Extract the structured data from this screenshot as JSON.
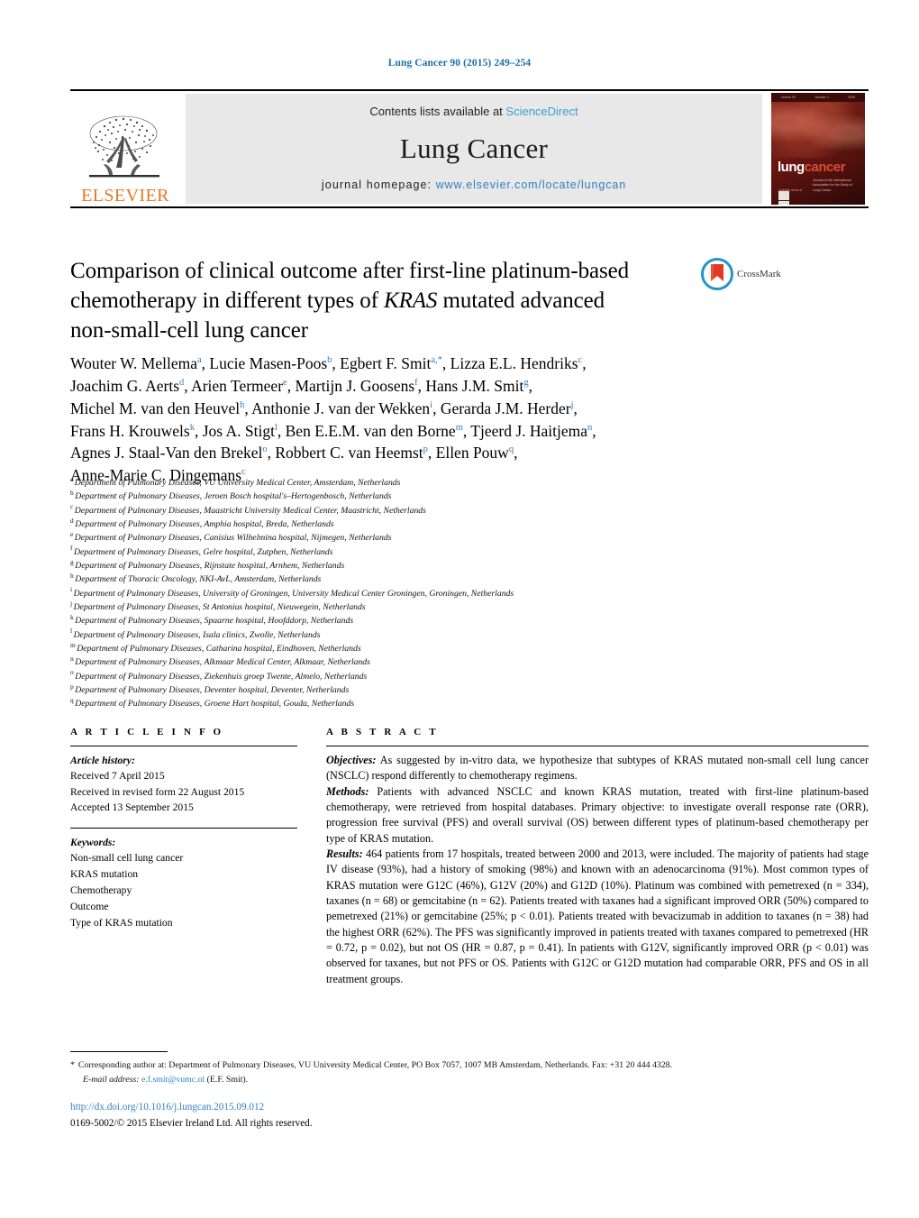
{
  "running_head": "Lung Cancer 90 (2015) 249–254",
  "masthead": {
    "publisher_name": "ELSEVIER",
    "contents_prefix": "Contents lists available at ",
    "contents_link": "ScienceDirect",
    "journal_title": "Lung Cancer",
    "homepage_label": "journal homepage:",
    "homepage_url": "www.elsevier.com/locate/lungcan",
    "cover": {
      "logo_first": "lung",
      "logo_second": "cancer",
      "subtitle": "Journal of the International Association for the Study of Lung Cancer",
      "availability": "Available online at"
    }
  },
  "article": {
    "title_line1": "Comparison of clinical outcome after first-line platinum-based",
    "title_line2_a": "chemotherapy in different types of ",
    "title_line2_italic": "KRAS",
    "title_line2_b": " mutated advanced",
    "title_line3": "non-small-cell lung cancer",
    "crossmark_label": "CrossMark"
  },
  "authors": [
    {
      "name": "Wouter W. Mellema",
      "sup": "a",
      "sep": ", "
    },
    {
      "name": "Lucie Masen-Poos",
      "sup": "b",
      "sep": ", "
    },
    {
      "name": "Egbert F. Smit",
      "sup": "a,*",
      "sep": ", "
    },
    {
      "name": "Lizza E.L. Hendriks",
      "sup": "c",
      "sep": ", "
    },
    {
      "name": "Joachim G. Aerts",
      "sup": "d",
      "sep": ", "
    },
    {
      "name": "Arien Termeer",
      "sup": "e",
      "sep": ", "
    },
    {
      "name": "Martijn J. Goosens",
      "sup": "f",
      "sep": ", "
    },
    {
      "name": "Hans J.M. Smit",
      "sup": "g",
      "sep": ", "
    },
    {
      "name": "Michel M. van den Heuvel",
      "sup": "h",
      "sep": ", "
    },
    {
      "name": "Anthonie J. van der Wekken",
      "sup": "i",
      "sep": ", "
    },
    {
      "name": "Gerarda J.M. Herder",
      "sup": "j",
      "sep": ", "
    },
    {
      "name": "Frans H. Krouwels",
      "sup": "k",
      "sep": ", "
    },
    {
      "name": "Jos A. Stigt",
      "sup": "l",
      "sep": ", "
    },
    {
      "name": "Ben E.E.M. van den Borne",
      "sup": "m",
      "sep": ", "
    },
    {
      "name": "Tjeerd J. Haitjema",
      "sup": "n",
      "sep": ", "
    },
    {
      "name": "Agnes J. Staal-Van den Brekel",
      "sup": "o",
      "sep": ", "
    },
    {
      "name": "Robbert C. van Heemst",
      "sup": "p",
      "sep": ", "
    },
    {
      "name": "Ellen Pouw",
      "sup": "q",
      "sep": ", "
    },
    {
      "name": "Anne-Marie C. Dingemans",
      "sup": "c",
      "sep": ""
    }
  ],
  "affiliations": [
    {
      "mark": "a",
      "text": "Department of Pulmonary Diseases, VU University Medical Center, Amsterdam, Netherlands"
    },
    {
      "mark": "b",
      "text": "Department of Pulmonary Diseases, Jeroen Bosch hospital's–Hertogenbosch, Netherlands"
    },
    {
      "mark": "c",
      "text": "Department of Pulmonary Diseases, Maastricht University Medical Center, Maastricht, Netherlands"
    },
    {
      "mark": "d",
      "text": "Department of Pulmonary Diseases, Amphia hospital, Breda, Netherlands"
    },
    {
      "mark": "e",
      "text": "Department of Pulmonary Diseases, Canisius Wilhelmina hospital, Nijmegen, Netherlands"
    },
    {
      "mark": "f",
      "text": "Department of Pulmonary Diseases, Gelre hospital, Zutphen, Netherlands"
    },
    {
      "mark": "g",
      "text": "Department of Pulmonary Diseases, Rijnstate hospital, Arnhem, Netherlands"
    },
    {
      "mark": "h",
      "text": "Department of Thoracic Oncology, NKI-AvL, Amsterdam, Netherlands"
    },
    {
      "mark": "i",
      "text": "Department of Pulmonary Diseases, University of Groningen, University Medical Center Groningen, Groningen, Netherlands"
    },
    {
      "mark": "j",
      "text": "Department of Pulmonary Diseases, St Antonius hospital, Nieuwegein, Netherlands"
    },
    {
      "mark": "k",
      "text": "Department of Pulmonary Diseases, Spaarne hospital, Hoofddorp, Netherlands"
    },
    {
      "mark": "l",
      "text": "Department of Pulmonary Diseases, Isala clinics, Zwolle, Netherlands"
    },
    {
      "mark": "m",
      "text": "Department of Pulmonary Diseases, Catharina hospital, Eindhoven, Netherlands"
    },
    {
      "mark": "n",
      "text": "Department of Pulmonary Diseases, Alkmaar Medical Center, Alkmaar, Netherlands"
    },
    {
      "mark": "o",
      "text": "Department of Pulmonary Diseases, Ziekenhuis groep Twente, Almelo, Netherlands"
    },
    {
      "mark": "p",
      "text": "Department of Pulmonary Diseases, Deventer hospital, Deventer, Netherlands"
    },
    {
      "mark": "q",
      "text": "Department of Pulmonary Diseases, Groene Hart hospital, Gouda, Netherlands"
    }
  ],
  "article_info": {
    "heading": "A R T I C L E   I N F O",
    "history_label": "Article history:",
    "history": [
      "Received 7 April 2015",
      "Received in revised form 22 August 2015",
      "Accepted 13 September 2015"
    ],
    "keywords_label": "Keywords:",
    "keywords": [
      "Non-small cell lung cancer",
      "KRAS mutation",
      "Chemotherapy",
      "Outcome",
      "Type of KRAS mutation"
    ]
  },
  "abstract": {
    "heading": "A B S T R A C T",
    "objectives_label": "Objectives:",
    "objectives_text": " As suggested by in-vitro data, we hypothesize that subtypes of KRAS mutated non-small cell lung cancer (NSCLC) respond differently to chemotherapy regimens.",
    "methods_label": "Methods:",
    "methods_text": " Patients with advanced NSCLC and known KRAS mutation, treated with first-line platinum-based chemotherapy, were retrieved from hospital databases. Primary objective: to investigate overall response rate (ORR), progression free survival (PFS) and overall survival (OS) between different types of platinum-based chemotherapy per type of KRAS mutation.",
    "results_label": "Results:",
    "results_text": " 464 patients from 17 hospitals, treated between 2000 and 2013, were included. The majority of patients had stage IV disease (93%), had a history of smoking (98%) and known with an adenocarcinoma (91%). Most common types of KRAS mutation were G12C (46%), G12V (20%) and G12D (10%). Platinum was combined with pemetrexed (n = 334), taxanes (n = 68) or gemcitabine (n = 62). Patients treated with taxanes had a significant improved ORR (50%) compared to pemetrexed (21%) or gemcitabine (25%; p < 0.01). Patients treated with bevacizumab in addition to taxanes (n = 38) had the highest ORR (62%). The PFS was significantly improved in patients treated with taxanes compared to pemetrexed (HR = 0.72, p = 0.02), but not OS (HR = 0.87, p = 0.41). In patients with G12V, significantly improved ORR (p < 0.01) was observed for taxanes, but not PFS or OS. Patients with G12C or G12D mutation had comparable ORR, PFS and OS in all treatment groups."
  },
  "footer": {
    "corresponding_star": "*",
    "corresponding_text": "Corresponding author at: Department of Pulmonary Diseases, VU University Medical Center, PO Box 7057, 1007 MB Amsterdam, Netherlands. Fax: +31 20 444 4328.",
    "email_label": "E-mail address:",
    "email": "e.f.smit@vumc.nl",
    "email_suffix": " (E.F. Smit).",
    "doi": "http://dx.doi.org/10.1016/j.lungcan.2015.09.012",
    "copyright": "0169-5002/© 2015 Elsevier Ireland Ltd. All rights reserved."
  },
  "colors": {
    "link_blue": "#2f7fbf",
    "sciencedirect_blue": "#3a9fd4",
    "elsevier_orange": "#E87722",
    "cover_red": "#7d1a14",
    "running_head_blue": "#1a6fa5"
  }
}
